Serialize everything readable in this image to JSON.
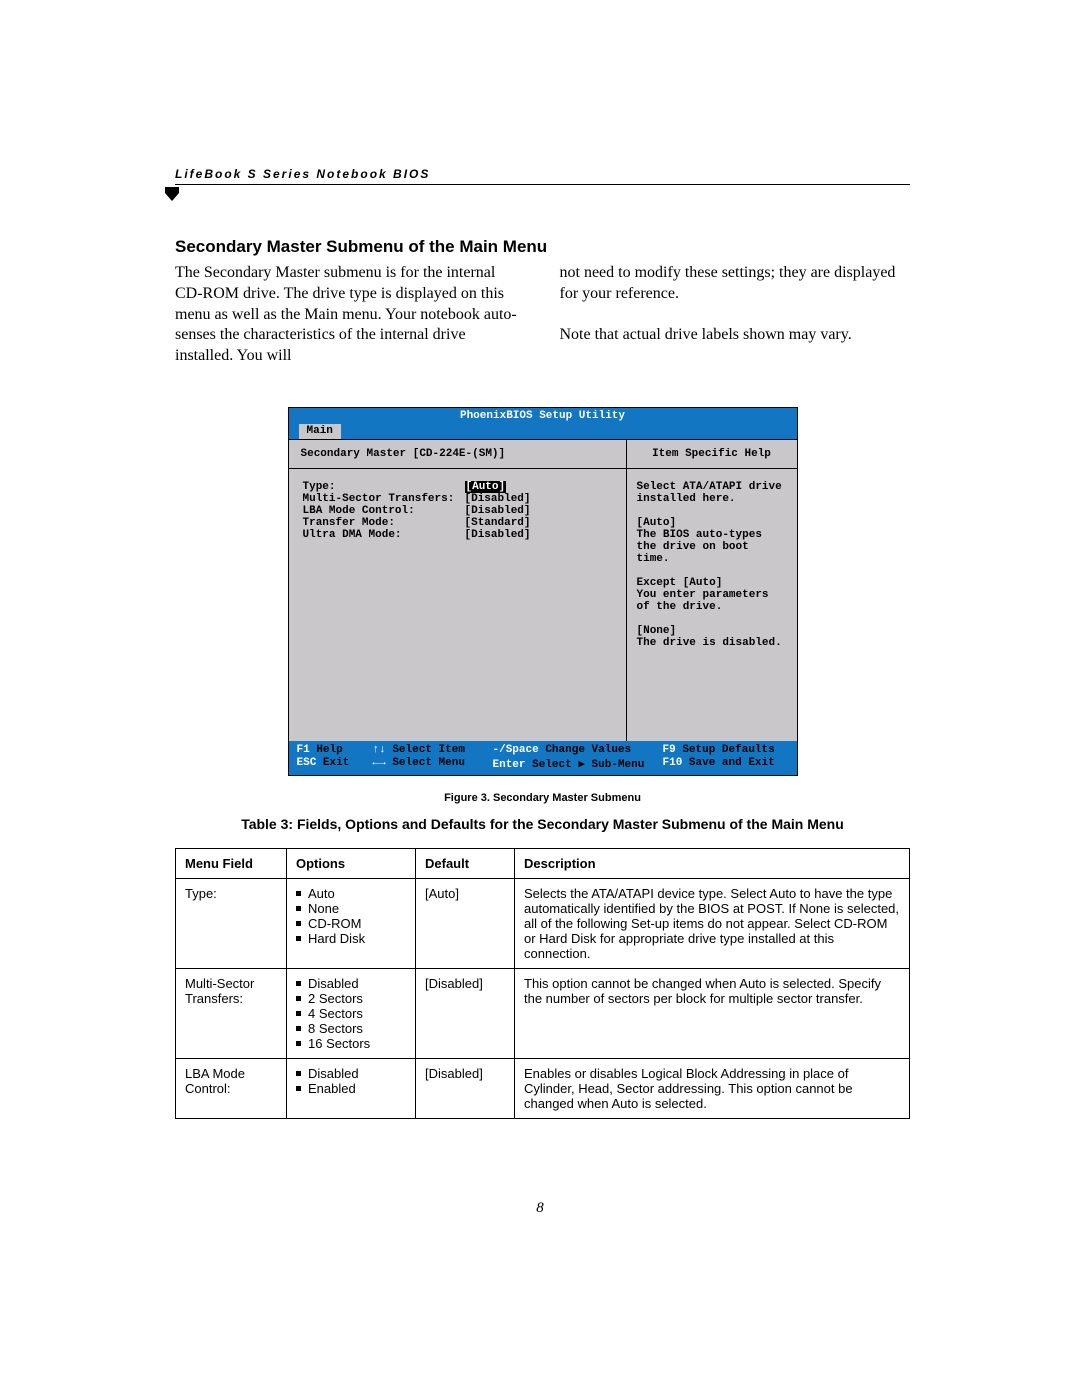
{
  "running_head": "LifeBook S Series Notebook BIOS",
  "section_title": "Secondary Master Submenu of the Main Menu",
  "body_para_left": "The Secondary Master submenu is for the internal CD-ROM drive. The drive type is displayed on this menu as well as the Main menu. Your notebook auto-senses the characteristics of the internal drive installed. You will",
  "body_para_right_1": "not need to modify these settings;  they are displayed for your reference.",
  "body_para_right_2": "Note that actual drive labels shown may vary.",
  "bios": {
    "title": "PhoenixBIOS Setup Utility",
    "active_tab": "Main",
    "sub_header": "Secondary Master [CD-224E-(SM)]",
    "help_header": "Item Specific Help",
    "params": [
      {
        "label": "Type:",
        "value": "[Auto]",
        "highlight": true
      },
      {
        "label": "",
        "value": ""
      },
      {
        "label": "Multi-Sector Transfers:",
        "value": "[Disabled]"
      },
      {
        "label": "LBA Mode Control:",
        "value": "[Disabled]"
      },
      {
        "label": "Transfer Mode:",
        "value": "[Standard]"
      },
      {
        "label": "Ultra DMA Mode:",
        "value": "[Disabled]"
      }
    ],
    "help_text": "Select ATA/ATAPI drive installed here.\n\n[Auto]\nThe BIOS auto-types the drive on boot time.\n\nExcept [Auto]\nYou enter parameters of the drive.\n\n[None]\nThe drive is disabled.",
    "footer": [
      {
        "key": "F1",
        "text": "Help"
      },
      {
        "key": "↑↓",
        "text": "Select Item"
      },
      {
        "key": "-/Space",
        "text": "Change Values"
      },
      {
        "key": "F9",
        "text": "Setup Defaults"
      },
      {
        "key": "ESC",
        "text": "Exit"
      },
      {
        "key": "←→",
        "text": "Select Menu"
      },
      {
        "key": "Enter",
        "text": "Select ▶ Sub-Menu"
      },
      {
        "key": "F10",
        "text": "Save and Exit"
      }
    ]
  },
  "figure_caption": "Figure 3.  Secondary Master Submenu",
  "table_title": "Table 3: Fields, Options and Defaults for the Secondary Master Submenu of the Main Menu",
  "table_headers": {
    "field": "Menu Field",
    "options": "Options",
    "default": "Default",
    "desc": "Description"
  },
  "table_rows": [
    {
      "field": "Type:",
      "options": [
        "Auto",
        "None",
        "CD-ROM",
        "Hard Disk"
      ],
      "default": "[Auto]",
      "desc": "Selects the ATA/ATAPI device type. Select Auto to have the type automatically identified by the BIOS at POST. If None is selected, all of the following Set-up items do not appear. Select CD-ROM or Hard Disk for appropriate drive type installed at this connection."
    },
    {
      "field": "Multi-Sector Transfers:",
      "options": [
        "Disabled",
        "2 Sectors",
        "4 Sectors",
        "8 Sectors",
        "16 Sectors"
      ],
      "default": "[Disabled]",
      "desc": "This option cannot be changed when Auto is selected. Specify the number of sectors per block for multiple sector transfer."
    },
    {
      "field": "LBA Mode Control:",
      "options": [
        "Disabled",
        "Enabled"
      ],
      "default": "[Disabled]",
      "desc": "Enables or disables Logical Block Addressing in place of Cylinder, Head, Sector addressing. This option cannot be changed when Auto is selected."
    }
  ],
  "page_number": "8"
}
